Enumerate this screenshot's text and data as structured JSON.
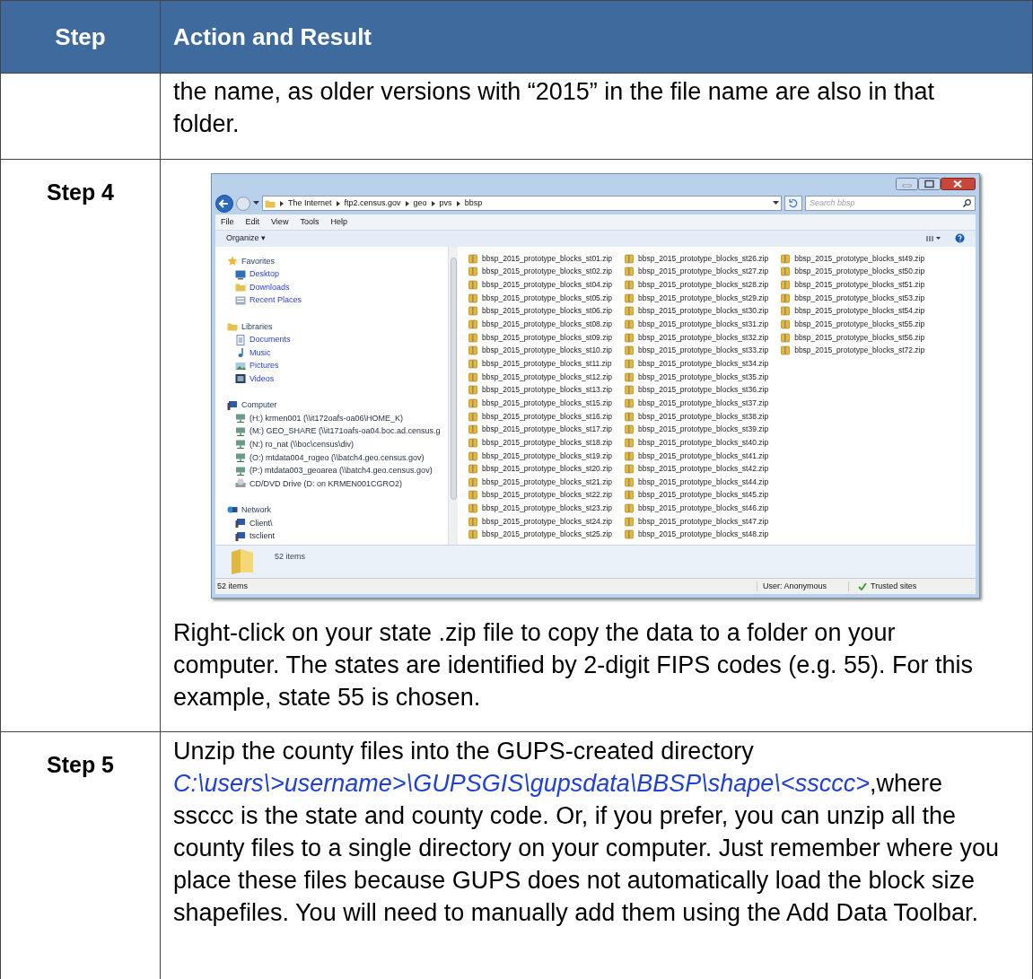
{
  "table": {
    "columns": [
      "Step",
      "Action and Result"
    ],
    "rows": [
      {
        "step": "",
        "content": [
          {
            "kind": "text",
            "segments": [
              {
                "kind": "text",
                "text": "the name, as older versions with “2015” in the file name are also in that folder."
              }
            ]
          }
        ]
      },
      {
        "step": "Step 4",
        "content": [
          {
            "kind": "screenshot"
          },
          {
            "kind": "text",
            "segments": [
              {
                "kind": "text",
                "text": "Right-click on your state .zip file to copy the data to a folder on your computer. The states are identified by 2-digit FIPS codes (e.g. 55). For this example, state 55 is chosen."
              }
            ]
          }
        ]
      },
      {
        "step": "Step 5",
        "content": [
          {
            "kind": "text",
            "segments": [
              {
                "kind": "text",
                "text": "Unzip the county files into the GUPS-created directory "
              },
              {
                "kind": "path",
                "text": "C:\\users\\>username>\\GUPSGIS\\gupsdata\\BBSP\\shape\\<ssccc>"
              },
              {
                "kind": "text",
                "text": ",where ssccc is the state and county code. Or, if you prefer, you can unzip all the county files to a single directory on your computer. Just remember where you place these files because GUPS does not automatically load the block size shapefiles. You will need to manually add them using the Add Data Toolbar."
              }
            ]
          }
        ]
      }
    ]
  },
  "explorer": {
    "breadcrumb": [
      "The Internet",
      "ftp2.census.gov",
      "geo",
      "pvs",
      "bbsp"
    ],
    "search": {
      "placeholder": "Search bbsp"
    },
    "menu": [
      "File",
      "Edit",
      "View",
      "Tools",
      "Help"
    ],
    "organize": "Organize ▾",
    "nav": [
      {
        "label": "Favorites",
        "kind": "star",
        "children": [
          {
            "label": "Desktop",
            "kind": "desktop"
          },
          {
            "label": "Downloads",
            "kind": "folder"
          },
          {
            "label": "Recent Places",
            "kind": "recent"
          }
        ]
      },
      {
        "label": "Libraries",
        "kind": "folder",
        "children": [
          {
            "label": "Documents",
            "kind": "doc"
          },
          {
            "label": "Music",
            "kind": "music"
          },
          {
            "label": "Pictures",
            "kind": "picture"
          },
          {
            "label": "Videos",
            "kind": "video"
          }
        ]
      },
      {
        "label": "Computer",
        "kind": "computer",
        "children": [
          {
            "label": "(H:) krmen001 (\\\\it172oafs-oa06\\HOME_K)",
            "kind": "drive"
          },
          {
            "label": "(M:) GEO_SHARE (\\\\it171oafs-oa04.boc.ad.census.g",
            "kind": "drive"
          },
          {
            "label": "(N:) ro_nat (\\\\boc\\census\\div)",
            "kind": "drive"
          },
          {
            "label": "(O:) mtdata004_rogeo (\\\\batch4.geo.census.gov)",
            "kind": "drive"
          },
          {
            "label": "(P:) mtdata003_geoarea (\\\\batch4.geo.census.gov)",
            "kind": "drive"
          },
          {
            "label": "CD/DVD Drive (D: on KRMEN001CGRO2)",
            "kind": "disc"
          }
        ]
      },
      {
        "label": "Network",
        "kind": "network",
        "children": [
          {
            "label": "Client\\",
            "kind": "computer"
          },
          {
            "label": "tsclient",
            "kind": "computer"
          }
        ]
      }
    ],
    "files": [
      "bbsp_2015_prototype_blocks_st01.zip",
      "bbsp_2015_prototype_blocks_st02.zip",
      "bbsp_2015_prototype_blocks_st04.zip",
      "bbsp_2015_prototype_blocks_st05.zip",
      "bbsp_2015_prototype_blocks_st06.zip",
      "bbsp_2015_prototype_blocks_st08.zip",
      "bbsp_2015_prototype_blocks_st09.zip",
      "bbsp_2015_prototype_blocks_st10.zip",
      "bbsp_2015_prototype_blocks_st11.zip",
      "bbsp_2015_prototype_blocks_st12.zip",
      "bbsp_2015_prototype_blocks_st13.zip",
      "bbsp_2015_prototype_blocks_st15.zip",
      "bbsp_2015_prototype_blocks_st16.zip",
      "bbsp_2015_prototype_blocks_st17.zip",
      "bbsp_2015_prototype_blocks_st18.zip",
      "bbsp_2015_prototype_blocks_st19.zip",
      "bbsp_2015_prototype_blocks_st20.zip",
      "bbsp_2015_prototype_blocks_st21.zip",
      "bbsp_2015_prototype_blocks_st22.zip",
      "bbsp_2015_prototype_blocks_st23.zip",
      "bbsp_2015_prototype_blocks_st24.zip",
      "bbsp_2015_prototype_blocks_st25.zip",
      "bbsp_2015_prototype_blocks_st26.zip",
      "bbsp_2015_prototype_blocks_st27.zip",
      "bbsp_2015_prototype_blocks_st28.zip",
      "bbsp_2015_prototype_blocks_st29.zip",
      "bbsp_2015_prototype_blocks_st30.zip",
      "bbsp_2015_prototype_blocks_st31.zip",
      "bbsp_2015_prototype_blocks_st32.zip",
      "bbsp_2015_prototype_blocks_st33.zip",
      "bbsp_2015_prototype_blocks_st34.zip",
      "bbsp_2015_prototype_blocks_st35.zip",
      "bbsp_2015_prototype_blocks_st36.zip",
      "bbsp_2015_prototype_blocks_st37.zip",
      "bbsp_2015_prototype_blocks_st38.zip",
      "bbsp_2015_prototype_blocks_st39.zip",
      "bbsp_2015_prototype_blocks_st40.zip",
      "bbsp_2015_prototype_blocks_st41.zip",
      "bbsp_2015_prototype_blocks_st42.zip",
      "bbsp_2015_prototype_blocks_st44.zip",
      "bbsp_2015_prototype_blocks_st45.zip",
      "bbsp_2015_prototype_blocks_st46.zip",
      "bbsp_2015_prototype_blocks_st47.zip",
      "bbsp_2015_prototype_blocks_st48.zip",
      "bbsp_2015_prototype_blocks_st49.zip",
      "bbsp_2015_prototype_blocks_st50.zip",
      "bbsp_2015_prototype_blocks_st51.zip",
      "bbsp_2015_prototype_blocks_st53.zip",
      "bbsp_2015_prototype_blocks_st54.zip",
      "bbsp_2015_prototype_blocks_st55.zip",
      "bbsp_2015_prototype_blocks_st56.zip",
      "bbsp_2015_prototype_blocks_st72.zip"
    ],
    "details": "52 items",
    "status": {
      "left": "52 items",
      "user": "User: Anonymous",
      "zone": "Trusted sites"
    }
  }
}
